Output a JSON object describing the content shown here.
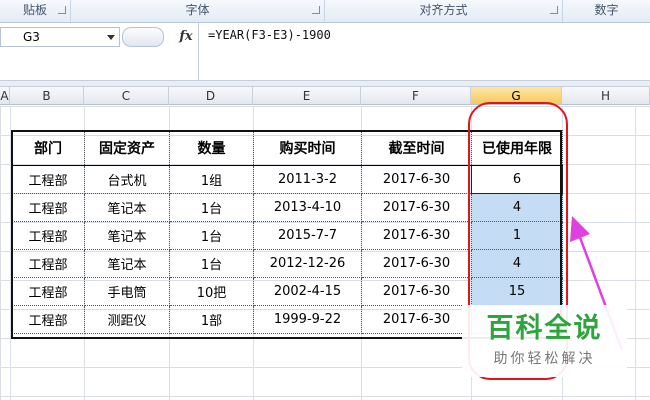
{
  "ribbon": {
    "groups": [
      "贴板",
      "字体",
      "对齐方式",
      "数字"
    ]
  },
  "formula_bar": {
    "name_box": "G3",
    "fx_label": "fx",
    "formula": "=YEAR(F3-E3)-1900"
  },
  "columns": [
    "A",
    "B",
    "C",
    "D",
    "E",
    "F",
    "G",
    "H"
  ],
  "active_column": "G",
  "table": {
    "headers": [
      "部门",
      "固定资产",
      "数量",
      "购买时间",
      "截至时间",
      "已使用年限"
    ],
    "rows": [
      [
        "工程部",
        "台式机",
        "1组",
        "2011-3-2",
        "2017-6-30",
        "6"
      ],
      [
        "工程部",
        "笔记本",
        "1台",
        "2013-4-10",
        "2017-6-30",
        "4"
      ],
      [
        "工程部",
        "笔记本",
        "1台",
        "2015-7-7",
        "2017-6-30",
        "1"
      ],
      [
        "工程部",
        "笔记本",
        "1台",
        "2012-12-26",
        "2017-6-30",
        "4"
      ],
      [
        "工程部",
        "手电筒",
        "10把",
        "2002-4-15",
        "2017-6-30",
        "15"
      ],
      [
        "工程部",
        "测距仪",
        "1部",
        "1999-9-22",
        "2017-6-30",
        ""
      ]
    ]
  },
  "watermark": {
    "title": "百科全说",
    "subtitle": "助你轻松解决"
  },
  "colors": {
    "selection": "#c5dcf5",
    "annotation_red": "#e0141a",
    "arrow_magenta": "#e040e0",
    "watermark_green": "#2fa33c"
  }
}
